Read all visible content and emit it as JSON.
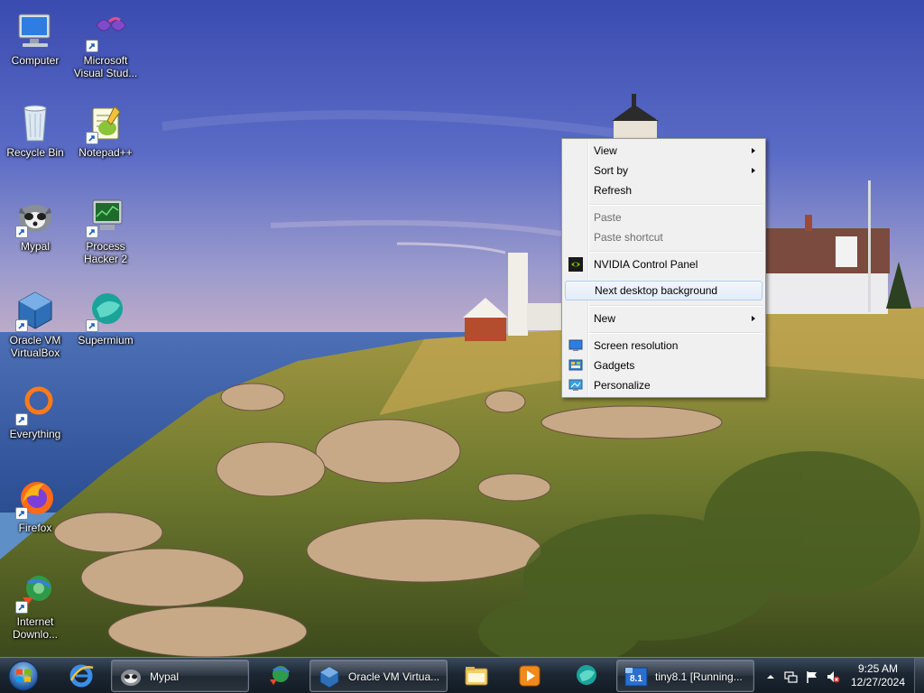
{
  "desktop": {
    "icons": [
      {
        "label": "Computer",
        "icon": "computer-icon"
      },
      {
        "label": "Microsoft Visual Stud...",
        "icon": "visual-studio-icon"
      },
      {
        "label": "Recycle Bin",
        "icon": "recycle-bin-icon"
      },
      {
        "label": "Notepad++",
        "icon": "notepad-plus-plus-icon"
      },
      {
        "label": "Mypal",
        "icon": "mypal-icon"
      },
      {
        "label": "Process Hacker 2",
        "icon": "process-hacker-icon"
      },
      {
        "label": "Oracle VM VirtualBox",
        "icon": "virtualbox-icon"
      },
      {
        "label": "Supermium",
        "icon": "supermium-icon"
      },
      {
        "label": "Everything",
        "icon": "everything-icon"
      },
      {
        "label": "Firefox",
        "icon": "firefox-icon"
      },
      {
        "label": "Internet Downlo...",
        "icon": "internet-download-manager-icon"
      }
    ]
  },
  "context_menu": {
    "items": {
      "view": "View",
      "sort_by": "Sort by",
      "refresh": "Refresh",
      "paste": "Paste",
      "paste_shortcut": "Paste shortcut",
      "nvidia": "NVIDIA Control Panel",
      "next_background": "Next desktop background",
      "new": "New",
      "screen_resolution": "Screen resolution",
      "gadgets": "Gadgets",
      "personalize": "Personalize"
    },
    "disabled": [
      "Paste",
      "Paste shortcut"
    ],
    "highlighted": "Next desktop background"
  },
  "taskbar": {
    "pinned": [
      "start-orb-icon",
      "internet-explorer-icon"
    ],
    "buttons": {
      "mypal": "Mypal",
      "virtualbox": "Oracle VM Virtua...",
      "tiny": "tiny8.1 [Running..."
    },
    "pinned_right": [
      "explorer-icon",
      "media-player-icon",
      "supermium-icon"
    ],
    "tray": [
      "show-hidden-icons",
      "network-icon",
      "action-center-flag-icon",
      "volume-muted-icon"
    ],
    "clock": {
      "time": "9:25 AM",
      "date": "12/27/2024"
    }
  },
  "colors": {
    "sky": "#4658b8",
    "sea": "#3a5fa8",
    "grass": "#8c8a3a",
    "menu_bg": "#f0f0f0",
    "menu_highlight_border": "#aecff7",
    "taskbar": "#1c2733"
  }
}
